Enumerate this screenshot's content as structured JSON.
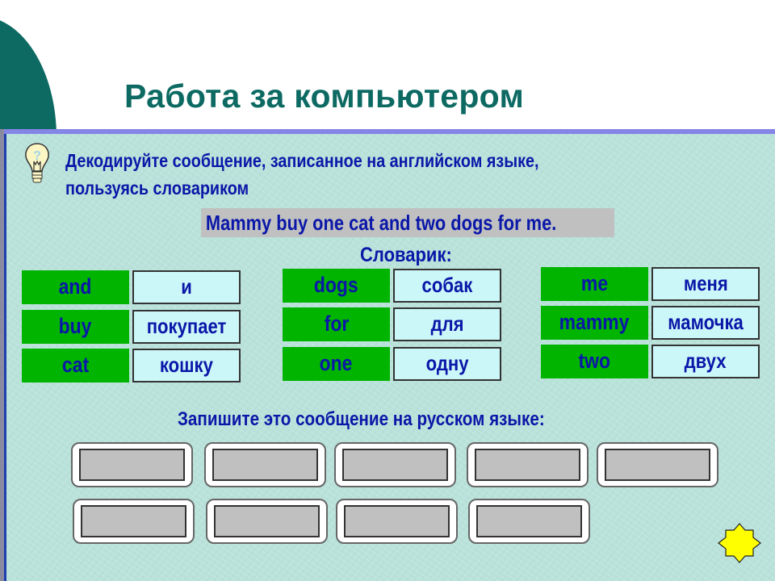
{
  "slide": {
    "title": "Работа за компьютером"
  },
  "task": {
    "instruction_line1": "Декодируйте сообщение, записанное на английском языке,",
    "instruction_line2": "пользуясь словариком",
    "message": "Mammy buy one cat and two dogs for me.",
    "icon": "lightbulb-question-icon"
  },
  "dictionary": {
    "title": "Словарик:",
    "columns": [
      [
        {
          "en": "and",
          "ru": "и"
        },
        {
          "en": "buy",
          "ru": "покупает"
        },
        {
          "en": "cat",
          "ru": "кошку"
        }
      ],
      [
        {
          "en": "dogs",
          "ru": "собак"
        },
        {
          "en": "for",
          "ru": "для"
        },
        {
          "en": "one",
          "ru": "одну"
        }
      ],
      [
        {
          "en": "me",
          "ru": "меня"
        },
        {
          "en": "mammy",
          "ru": "мамочка"
        },
        {
          "en": "two",
          "ru": "двух"
        }
      ]
    ]
  },
  "answer": {
    "prompt": "Запишите это сообщение на русском языке:",
    "slot_count_row1": 5,
    "slot_count_row2": 4
  },
  "colors": {
    "title": "#0d6a63",
    "text": "#0a17a8",
    "english_cell": "#00b400",
    "russian_cell": "#ccf7f9",
    "slot_fill": "#c0c0c0",
    "star": "#ffff00"
  },
  "controls": {
    "next_icon": "star-icon"
  }
}
